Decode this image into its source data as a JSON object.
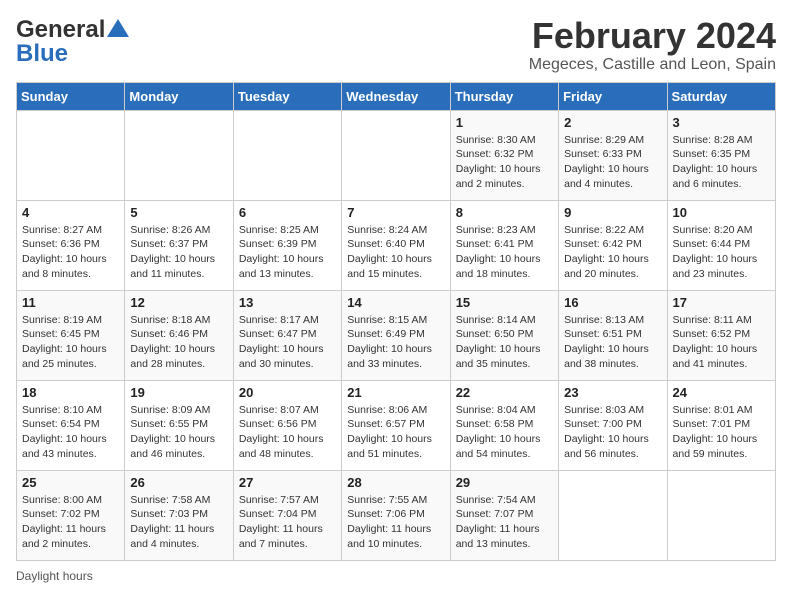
{
  "header": {
    "logo_line1": "General",
    "logo_line2": "Blue",
    "title": "February 2024",
    "subtitle": "Megeces, Castille and Leon, Spain"
  },
  "columns": [
    "Sunday",
    "Monday",
    "Tuesday",
    "Wednesday",
    "Thursday",
    "Friday",
    "Saturday"
  ],
  "weeks": [
    [
      {
        "day": "",
        "info": ""
      },
      {
        "day": "",
        "info": ""
      },
      {
        "day": "",
        "info": ""
      },
      {
        "day": "",
        "info": ""
      },
      {
        "day": "1",
        "info": "Sunrise: 8:30 AM\nSunset: 6:32 PM\nDaylight: 10 hours\nand 2 minutes."
      },
      {
        "day": "2",
        "info": "Sunrise: 8:29 AM\nSunset: 6:33 PM\nDaylight: 10 hours\nand 4 minutes."
      },
      {
        "day": "3",
        "info": "Sunrise: 8:28 AM\nSunset: 6:35 PM\nDaylight: 10 hours\nand 6 minutes."
      }
    ],
    [
      {
        "day": "4",
        "info": "Sunrise: 8:27 AM\nSunset: 6:36 PM\nDaylight: 10 hours\nand 8 minutes."
      },
      {
        "day": "5",
        "info": "Sunrise: 8:26 AM\nSunset: 6:37 PM\nDaylight: 10 hours\nand 11 minutes."
      },
      {
        "day": "6",
        "info": "Sunrise: 8:25 AM\nSunset: 6:39 PM\nDaylight: 10 hours\nand 13 minutes."
      },
      {
        "day": "7",
        "info": "Sunrise: 8:24 AM\nSunset: 6:40 PM\nDaylight: 10 hours\nand 15 minutes."
      },
      {
        "day": "8",
        "info": "Sunrise: 8:23 AM\nSunset: 6:41 PM\nDaylight: 10 hours\nand 18 minutes."
      },
      {
        "day": "9",
        "info": "Sunrise: 8:22 AM\nSunset: 6:42 PM\nDaylight: 10 hours\nand 20 minutes."
      },
      {
        "day": "10",
        "info": "Sunrise: 8:20 AM\nSunset: 6:44 PM\nDaylight: 10 hours\nand 23 minutes."
      }
    ],
    [
      {
        "day": "11",
        "info": "Sunrise: 8:19 AM\nSunset: 6:45 PM\nDaylight: 10 hours\nand 25 minutes."
      },
      {
        "day": "12",
        "info": "Sunrise: 8:18 AM\nSunset: 6:46 PM\nDaylight: 10 hours\nand 28 minutes."
      },
      {
        "day": "13",
        "info": "Sunrise: 8:17 AM\nSunset: 6:47 PM\nDaylight: 10 hours\nand 30 minutes."
      },
      {
        "day": "14",
        "info": "Sunrise: 8:15 AM\nSunset: 6:49 PM\nDaylight: 10 hours\nand 33 minutes."
      },
      {
        "day": "15",
        "info": "Sunrise: 8:14 AM\nSunset: 6:50 PM\nDaylight: 10 hours\nand 35 minutes."
      },
      {
        "day": "16",
        "info": "Sunrise: 8:13 AM\nSunset: 6:51 PM\nDaylight: 10 hours\nand 38 minutes."
      },
      {
        "day": "17",
        "info": "Sunrise: 8:11 AM\nSunset: 6:52 PM\nDaylight: 10 hours\nand 41 minutes."
      }
    ],
    [
      {
        "day": "18",
        "info": "Sunrise: 8:10 AM\nSunset: 6:54 PM\nDaylight: 10 hours\nand 43 minutes."
      },
      {
        "day": "19",
        "info": "Sunrise: 8:09 AM\nSunset: 6:55 PM\nDaylight: 10 hours\nand 46 minutes."
      },
      {
        "day": "20",
        "info": "Sunrise: 8:07 AM\nSunset: 6:56 PM\nDaylight: 10 hours\nand 48 minutes."
      },
      {
        "day": "21",
        "info": "Sunrise: 8:06 AM\nSunset: 6:57 PM\nDaylight: 10 hours\nand 51 minutes."
      },
      {
        "day": "22",
        "info": "Sunrise: 8:04 AM\nSunset: 6:58 PM\nDaylight: 10 hours\nand 54 minutes."
      },
      {
        "day": "23",
        "info": "Sunrise: 8:03 AM\nSunset: 7:00 PM\nDaylight: 10 hours\nand 56 minutes."
      },
      {
        "day": "24",
        "info": "Sunrise: 8:01 AM\nSunset: 7:01 PM\nDaylight: 10 hours\nand 59 minutes."
      }
    ],
    [
      {
        "day": "25",
        "info": "Sunrise: 8:00 AM\nSunset: 7:02 PM\nDaylight: 11 hours\nand 2 minutes."
      },
      {
        "day": "26",
        "info": "Sunrise: 7:58 AM\nSunset: 7:03 PM\nDaylight: 11 hours\nand 4 minutes."
      },
      {
        "day": "27",
        "info": "Sunrise: 7:57 AM\nSunset: 7:04 PM\nDaylight: 11 hours\nand 7 minutes."
      },
      {
        "day": "28",
        "info": "Sunrise: 7:55 AM\nSunset: 7:06 PM\nDaylight: 11 hours\nand 10 minutes."
      },
      {
        "day": "29",
        "info": "Sunrise: 7:54 AM\nSunset: 7:07 PM\nDaylight: 11 hours\nand 13 minutes."
      },
      {
        "day": "",
        "info": ""
      },
      {
        "day": "",
        "info": ""
      }
    ]
  ],
  "footer": {
    "daylight_label": "Daylight hours"
  },
  "colors": {
    "header_bg": "#2a6ebb",
    "header_text": "#ffffff",
    "accent_blue": "#1a6bb5"
  }
}
